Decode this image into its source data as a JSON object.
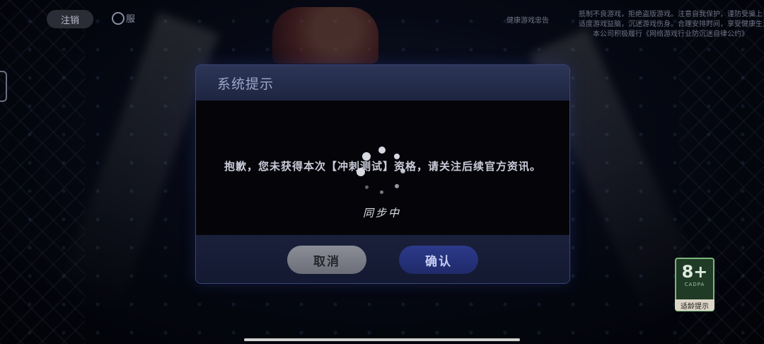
{
  "topbar": {
    "logout_label": "注销",
    "headset_label": "服",
    "health_title": "健康游戏忠告"
  },
  "health_notice": [
    "抵制不良游戏，拒绝盗版游戏。注意自我保护，谨防受骗上当。",
    "适度游戏益脑，沉迷游戏伤身。合理安排时间，享受健康生活。",
    "本公司积极履行《网络游戏行业防沉迷自律公约》"
  ],
  "dialog": {
    "title": "系统提示",
    "message": "抱歉，您未获得本次【冲刺测试】资格，请关注后续官方资讯。",
    "cancel_label": "取消",
    "confirm_label": "确认"
  },
  "loading": {
    "text": "同步中"
  },
  "age_rating": {
    "value": "8+",
    "org": "CADPA",
    "tip_label": "适龄提示"
  }
}
